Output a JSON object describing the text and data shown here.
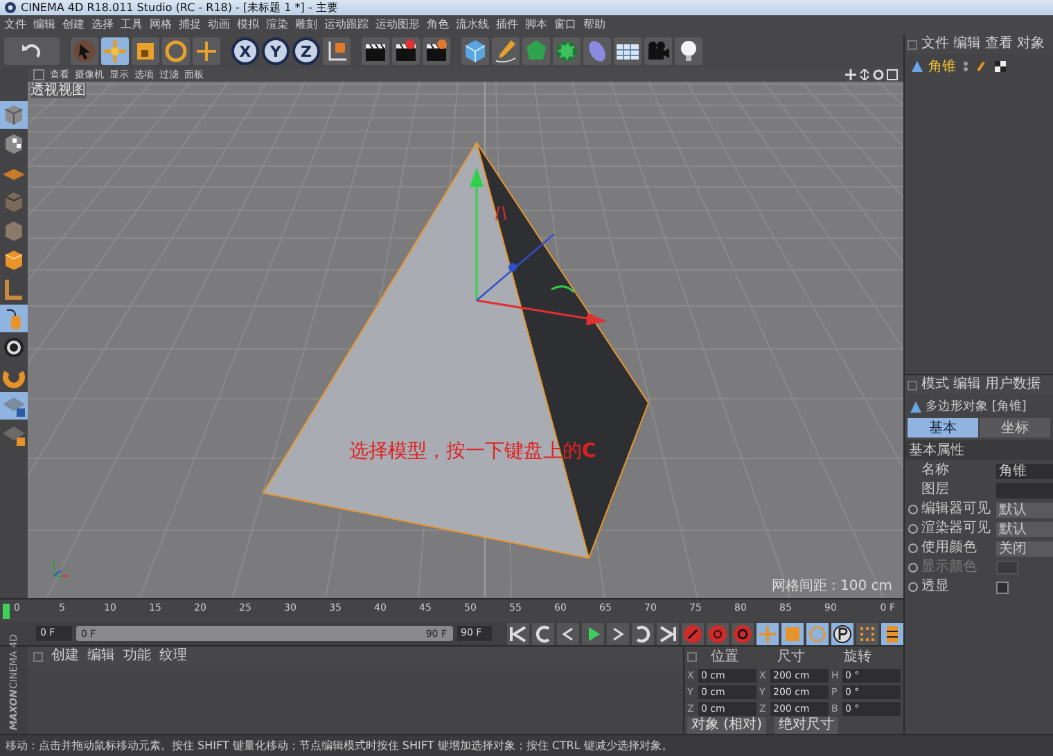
{
  "window": {
    "title": "CINEMA 4D R18.011 Studio (RC - R18) - [未标题 1 *] - 主要"
  },
  "menu_bar": [
    "文件",
    "编辑",
    "创建",
    "选择",
    "工具",
    "网格",
    "捕捉",
    "动画",
    "模拟",
    "渲染",
    "雕刻",
    "运动跟踪",
    "运动图形",
    "角色",
    "流水线",
    "插件",
    "脚本",
    "窗口",
    "帮助"
  ],
  "toolbar": {
    "axis_buttons": [
      "X",
      "Y",
      "Z"
    ]
  },
  "viewport": {
    "menu": [
      "查看",
      "摄像机",
      "显示",
      "选项",
      "过滤",
      "面板"
    ],
    "label": "透视视图",
    "annotation": "选择模型，按一下键盘上的**C**",
    "grid_spacing": "网格间距 : 100 cm"
  },
  "object_manager": {
    "menu": [
      "文件",
      "编辑",
      "查看",
      "对象"
    ],
    "objects": [
      {
        "name": "角锥",
        "selected": true
      }
    ]
  },
  "attributes": {
    "menu": [
      "模式",
      "编辑",
      "用户数据"
    ],
    "title": "多边形对象 [角锥]",
    "tabs": [
      {
        "label": "基本",
        "selected": true
      },
      {
        "label": "坐标",
        "selected": false
      }
    ],
    "section": "基本属性",
    "fields": [
      {
        "kind": "text",
        "label": "名称",
        "value": "角锥",
        "disabled": false
      },
      {
        "kind": "text",
        "label": "图层",
        "disabled": false
      },
      {
        "kind": "dropdown",
        "label": "编辑器可见",
        "value": "默认",
        "disabled": false
      },
      {
        "kind": "dropdown",
        "label": "渲染器可见",
        "value": "默认",
        "disabled": false
      },
      {
        "kind": "dropdown",
        "label": "使用颜色",
        "value": "关闭",
        "disabled": false
      },
      {
        "kind": "color",
        "label": "显示颜色",
        "disabled": true
      },
      {
        "kind": "checkbox",
        "label": "透显",
        "checked": false,
        "disabled": false
      }
    ]
  },
  "timeline": {
    "ticks": [
      "0",
      "5",
      "10",
      "15",
      "20",
      "25",
      "30",
      "35",
      "40",
      "45",
      "50",
      "55",
      "60",
      "65",
      "70",
      "75",
      "80",
      "85",
      "90"
    ],
    "current_frame": "0 F",
    "start_field": "0 F",
    "range": {
      "start": "0 F",
      "end": "90 F",
      "level": 1
    },
    "end_field": "90 F"
  },
  "material_manager": {
    "menu": [
      "创建",
      "编辑",
      "功能",
      "纹理"
    ]
  },
  "coordinates": {
    "headers": [
      "位置",
      "尺寸",
      "旋转"
    ],
    "rows": [
      {
        "axis": "X",
        "position": "0 cm",
        "size_axis": "X",
        "size": "200 cm",
        "rot_axis": "H",
        "rotation": "0 °"
      },
      {
        "axis": "Y",
        "position": "0 cm",
        "size_axis": "Y",
        "size": "200 cm",
        "rot_axis": "P",
        "rotation": "0 °"
      },
      {
        "axis": "Z",
        "position": "0 cm",
        "size_axis": "Z",
        "size": "200 cm",
        "rot_axis": "B",
        "rotation": "0 °"
      }
    ],
    "dropdowns": [
      "对象 (相对)",
      "绝对尺寸"
    ]
  },
  "logo": {
    "brand": "MAXON",
    "product": "CINEMA 4D"
  },
  "status_bar": "移动：点击并拖动鼠标移动元素。按住 SHIFT 键量化移动；节点编辑模式时按住 SHIFT 键增加选择对象；按住 CTRL 键减少选择对象。"
}
